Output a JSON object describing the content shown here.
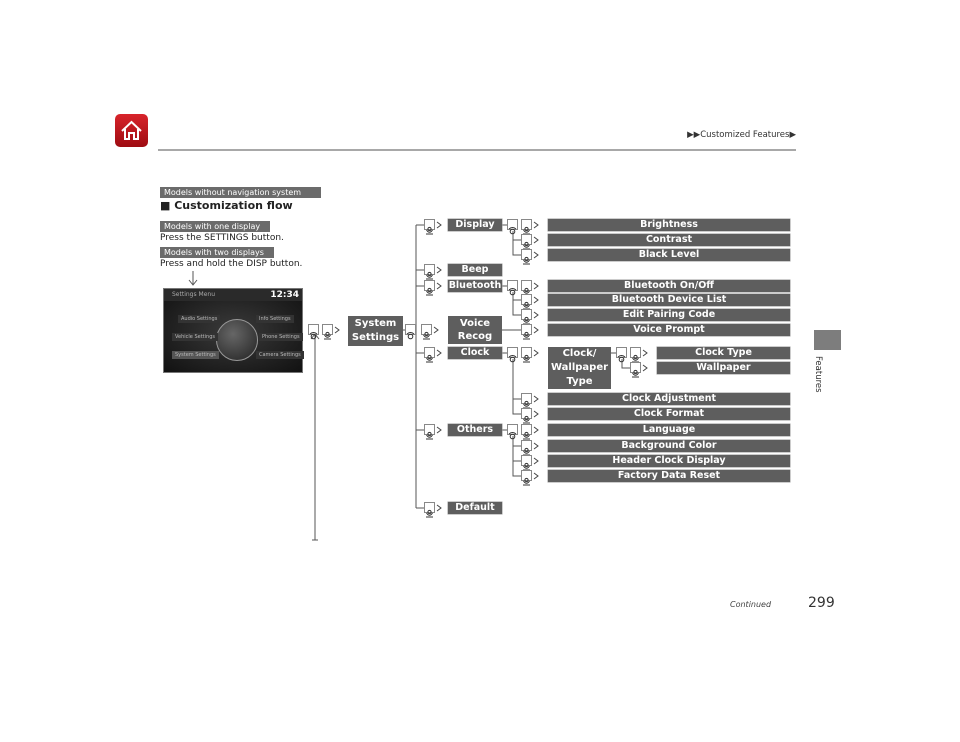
{
  "header": {
    "breadcrumb": "▶▶Customized Features▶",
    "home_icon": "home-icon",
    "home_color": "#c8161d"
  },
  "section": {
    "model_tag": "Models without navigation system",
    "title": "■ Customization flow",
    "one_display_tag": "Models with one display",
    "one_display_text": "Press the SETTINGS button.",
    "two_display_tag": "Models with two displays",
    "two_display_text": "Press and hold the DISP button."
  },
  "screen": {
    "title": "Settings Menu",
    "time": "12:34",
    "items": [
      "Audio Settings",
      "Info Settings",
      "Vehicle Settings",
      "Phone Settings",
      "System Settings",
      "Camera Settings"
    ]
  },
  "flow": {
    "root": "System Settings",
    "categories": {
      "display": "Display",
      "beep": "Beep",
      "bluetooth": "Bluetooth",
      "voice": "Voice Recog",
      "clock": "Clock",
      "others": "Others",
      "default": "Default"
    },
    "display_items": [
      "Brightness",
      "Contrast",
      "Black Level"
    ],
    "bluetooth_items": [
      "Bluetooth On/Off",
      "Bluetooth Device List",
      "Edit Pairing Code"
    ],
    "voice_items": [
      "Voice Prompt"
    ],
    "clock_sub": "Clock/ Wallpaper Type",
    "clock_sub_items": [
      "Clock Type",
      "Wallpaper"
    ],
    "clock_items": [
      "Clock Adjustment",
      "Clock Format"
    ],
    "others_items": [
      "Language",
      "Background Color",
      "Header Clock Display",
      "Factory Data Reset"
    ],
    "icons": [
      "rotate-dial-icon",
      "press-button-icon"
    ]
  },
  "side_tab": {
    "label": "Features"
  },
  "footer": {
    "continued": "Continued",
    "page": "299"
  }
}
